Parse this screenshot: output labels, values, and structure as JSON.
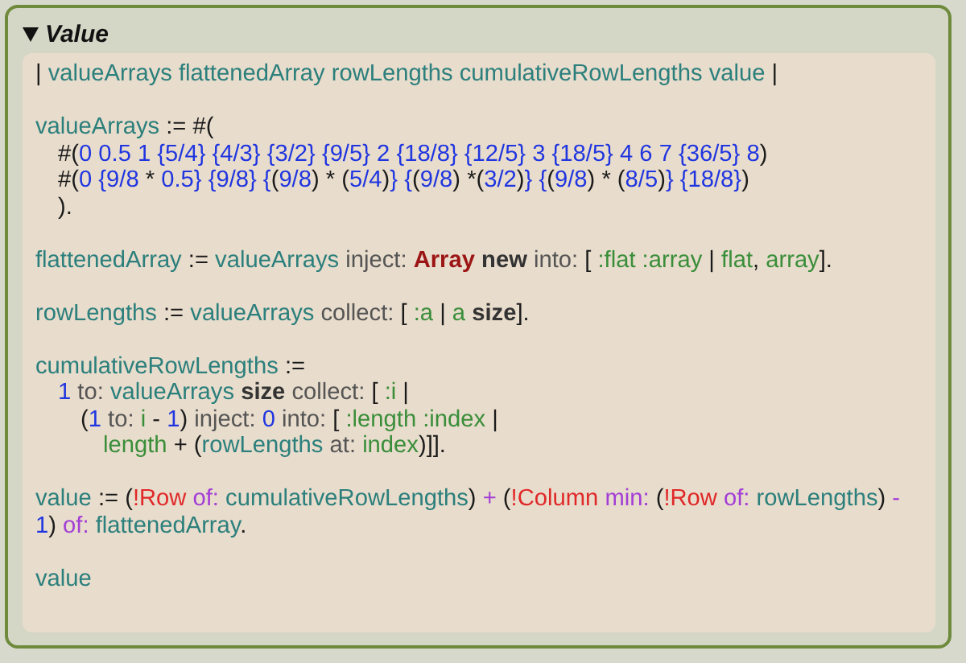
{
  "header": {
    "title": "Value",
    "expanded": true
  },
  "statements": [
    {
      "tokens": [
        {
          "kind": "punct",
          "text": "| "
        },
        {
          "kind": "var",
          "text": "valueArrays flattenedArray rowLengths cumulativeRowLengths value"
        },
        {
          "kind": "punct",
          "text": " |"
        }
      ]
    },
    {
      "tokens": [
        {
          "kind": "var",
          "text": "valueArrays"
        },
        {
          "kind": "punct",
          "text": " := #("
        }
      ],
      "children": [
        {
          "tokens": [
            {
              "kind": "punct",
              "text": "#("
            },
            {
              "kind": "num",
              "text": "0 0.5 1 {5/4} {4/3} {3/2} {9/5} 2 {18/8} {12/5} 3 {18/5} 4 6 7 {36/5} 8"
            },
            {
              "kind": "punct",
              "text": ")"
            }
          ]
        },
        {
          "tokens": [
            {
              "kind": "punct",
              "text": "#("
            },
            {
              "kind": "num",
              "text": "0 {9/8"
            },
            {
              "kind": "punct",
              "text": " * "
            },
            {
              "kind": "num",
              "text": "0.5} {9/8} {"
            },
            {
              "kind": "punct",
              "text": "("
            },
            {
              "kind": "num",
              "text": "9/8"
            },
            {
              "kind": "punct",
              "text": ") * ("
            },
            {
              "kind": "num",
              "text": "5/4"
            },
            {
              "kind": "punct",
              "text": ")"
            },
            {
              "kind": "num",
              "text": "} {"
            },
            {
              "kind": "punct",
              "text": "("
            },
            {
              "kind": "num",
              "text": "9/8"
            },
            {
              "kind": "punct",
              "text": ") *("
            },
            {
              "kind": "num",
              "text": "3/2"
            },
            {
              "kind": "punct",
              "text": ")"
            },
            {
              "kind": "num",
              "text": "} {"
            },
            {
              "kind": "punct",
              "text": "("
            },
            {
              "kind": "num",
              "text": "9/8"
            },
            {
              "kind": "punct",
              "text": ") * ("
            },
            {
              "kind": "num",
              "text": "8/5"
            },
            {
              "kind": "punct",
              "text": ")"
            },
            {
              "kind": "num",
              "text": "} {18/8}"
            },
            {
              "kind": "punct",
              "text": ")"
            }
          ]
        },
        {
          "tokens": [
            {
              "kind": "punct",
              "text": ")."
            }
          ]
        }
      ]
    },
    {
      "tokens": [
        {
          "kind": "var",
          "text": "flattenedArray"
        },
        {
          "kind": "punct",
          "text": " := "
        },
        {
          "kind": "var",
          "text": "valueArrays"
        },
        {
          "kind": "msg",
          "text": " inject: "
        },
        {
          "kind": "class",
          "text": "Array"
        },
        {
          "kind": "unary",
          "text": " new"
        },
        {
          "kind": "msg",
          "text": " into: "
        },
        {
          "kind": "punct",
          "text": "[ "
        },
        {
          "kind": "arg",
          "text": ":flat :array"
        },
        {
          "kind": "punct",
          "text": " | "
        },
        {
          "kind": "arg",
          "text": "flat"
        },
        {
          "kind": "punct",
          "text": ", "
        },
        {
          "kind": "arg",
          "text": "array"
        },
        {
          "kind": "punct",
          "text": "]."
        }
      ]
    },
    {
      "tokens": [
        {
          "kind": "var",
          "text": "rowLengths"
        },
        {
          "kind": "punct",
          "text": " := "
        },
        {
          "kind": "var",
          "text": "valueArrays"
        },
        {
          "kind": "msg",
          "text": " collect: "
        },
        {
          "kind": "punct",
          "text": "[ "
        },
        {
          "kind": "arg",
          "text": ":a"
        },
        {
          "kind": "punct",
          "text": " | "
        },
        {
          "kind": "arg",
          "text": "a"
        },
        {
          "kind": "unary",
          "text": " size"
        },
        {
          "kind": "punct",
          "text": "]."
        }
      ]
    },
    {
      "tokens": [
        {
          "kind": "var",
          "text": "cumulativeRowLengths"
        },
        {
          "kind": "punct",
          "text": " :="
        }
      ],
      "children": [
        {
          "tokens": [
            {
              "kind": "num",
              "text": "1"
            },
            {
              "kind": "msg",
              "text": " to: "
            },
            {
              "kind": "var",
              "text": "valueArrays"
            },
            {
              "kind": "unary",
              "text": " size"
            },
            {
              "kind": "msg",
              "text": " collect: "
            },
            {
              "kind": "punct",
              "text": "[ "
            },
            {
              "kind": "arg",
              "text": ":i"
            },
            {
              "kind": "punct",
              "text": " |"
            }
          ],
          "children": [
            {
              "tokens": [
                {
                  "kind": "punct",
                  "text": "("
                },
                {
                  "kind": "num",
                  "text": "1"
                },
                {
                  "kind": "msg",
                  "text": " to: "
                },
                {
                  "kind": "arg",
                  "text": "i"
                },
                {
                  "kind": "punct",
                  "text": " - "
                },
                {
                  "kind": "num",
                  "text": "1"
                },
                {
                  "kind": "punct",
                  "text": ")"
                },
                {
                  "kind": "msg",
                  "text": " inject: "
                },
                {
                  "kind": "num",
                  "text": "0"
                },
                {
                  "kind": "msg",
                  "text": " into: "
                },
                {
                  "kind": "punct",
                  "text": "[ "
                },
                {
                  "kind": "arg",
                  "text": ":length :index"
                },
                {
                  "kind": "punct",
                  "text": " |"
                }
              ],
              "children": [
                {
                  "tokens": [
                    {
                      "kind": "arg",
                      "text": "length"
                    },
                    {
                      "kind": "punct",
                      "text": " + ("
                    },
                    {
                      "kind": "var",
                      "text": "rowLengths"
                    },
                    {
                      "kind": "msg",
                      "text": " at: "
                    },
                    {
                      "kind": "arg",
                      "text": "index"
                    },
                    {
                      "kind": "punct",
                      "text": ")]]."
                    }
                  ]
                }
              ]
            }
          ]
        }
      ]
    },
    {
      "tokens": [
        {
          "kind": "var",
          "text": "value"
        },
        {
          "kind": "punct",
          "text": " := ("
        },
        {
          "kind": "ext",
          "text": "!Row"
        },
        {
          "kind": "key",
          "text": " of: "
        },
        {
          "kind": "var",
          "text": "cumulativeRowLengths"
        },
        {
          "kind": "punct",
          "text": ") "
        },
        {
          "kind": "key",
          "text": "+"
        },
        {
          "kind": "punct",
          "text": " ("
        },
        {
          "kind": "ext",
          "text": "!Column"
        },
        {
          "kind": "key",
          "text": " min: "
        },
        {
          "kind": "punct",
          "text": "("
        },
        {
          "kind": "ext",
          "text": "!Row"
        },
        {
          "kind": "key",
          "text": " of: "
        },
        {
          "kind": "var",
          "text": "rowLengths"
        },
        {
          "kind": "punct",
          "text": ") "
        },
        {
          "kind": "key",
          "text": "- "
        },
        {
          "kind": "num",
          "text": "1"
        },
        {
          "kind": "punct",
          "text": ")"
        },
        {
          "kind": "key",
          "text": " of: "
        },
        {
          "kind": "var",
          "text": "flattenedArray"
        },
        {
          "kind": "punct",
          "text": "."
        }
      ]
    },
    {
      "tokens": [
        {
          "kind": "var",
          "text": "value"
        }
      ]
    }
  ]
}
